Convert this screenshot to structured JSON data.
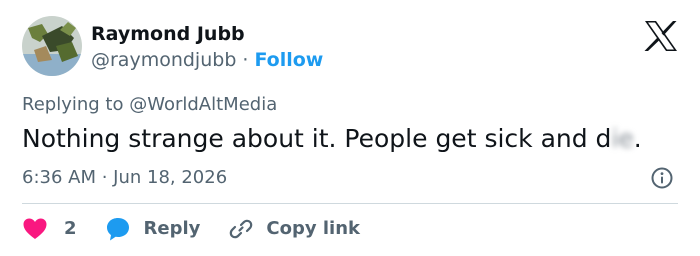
{
  "author": {
    "display_name": "Raymond Jubb",
    "handle": "@raymondjubb",
    "separator": "·",
    "follow_label": "Follow"
  },
  "reply_context": {
    "prefix": "Replying to ",
    "target": "@WorldAltMedia"
  },
  "tweet": {
    "text_before": "Nothing strange about it. People get sick and d",
    "redacted": "ie",
    "text_after": ".",
    "timestamp": "6:36 AM · Jun 18, 2026"
  },
  "actions": {
    "like_count": "2",
    "reply_label": "Reply",
    "copy_label": "Copy link"
  },
  "icons": {
    "logo": "x-logo-icon",
    "info": "info-icon",
    "like": "heart-icon",
    "reply": "speech-bubble-icon",
    "copy": "link-icon"
  },
  "colors": {
    "accent": "#1d9bf0",
    "like": "#f91880",
    "text_primary": "#0f1419",
    "text_secondary": "#536471",
    "divider": "#cfd9de"
  }
}
